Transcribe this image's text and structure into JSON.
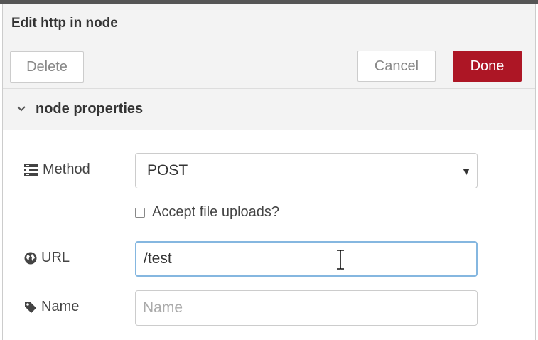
{
  "dialog": {
    "title": "Edit http in node",
    "buttons": {
      "delete_label": "Delete",
      "cancel_label": "Cancel",
      "done_label": "Done"
    },
    "section": {
      "title": "node properties",
      "expanded": true
    }
  },
  "form": {
    "method": {
      "label": "Method",
      "icon": "list-icon",
      "value": "POST"
    },
    "upload": {
      "label": "Accept file uploads?",
      "checked": false
    },
    "url": {
      "label": "URL",
      "icon": "globe-icon",
      "value": "/test"
    },
    "name": {
      "label": "Name",
      "icon": "tag-icon",
      "value": "",
      "placeholder": "Name"
    }
  },
  "colors": {
    "done_button": "#ad1625",
    "focus_border": "#85b7e0",
    "panel_background": "#f3f3f3"
  }
}
